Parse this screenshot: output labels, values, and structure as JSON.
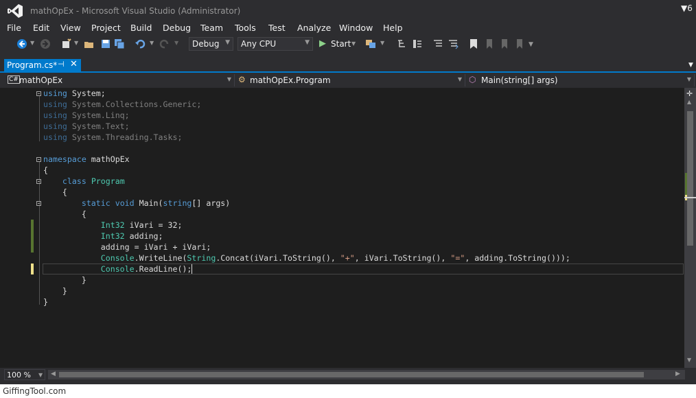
{
  "window": {
    "title": "mathOpEx - Microsoft Visual Studio (Administrator)",
    "notify_count": "6"
  },
  "menu": [
    "File",
    "Edit",
    "View",
    "Project",
    "Build",
    "Debug",
    "Team",
    "Tools",
    "Test",
    "Analyze",
    "Window",
    "Help"
  ],
  "toolbar": {
    "config": "Debug",
    "platform": "Any CPU",
    "start_label": "Start"
  },
  "tab": {
    "label": "Program.cs*"
  },
  "nav": {
    "project": "mathOpEx",
    "class": "mathOpEx.Program",
    "member": "Main(string[] args)"
  },
  "code": {
    "l1": [
      "using",
      " System;"
    ],
    "l2": [
      "using",
      " System.Collections.Generic;"
    ],
    "l3": [
      "using",
      " System.Linq;"
    ],
    "l4": [
      "using",
      " System.Text;"
    ],
    "l5": [
      "using",
      " System.Threading.Tasks;"
    ],
    "l7": [
      "namespace",
      " mathOpEx"
    ],
    "l8": "{",
    "l9": [
      "class",
      "Program"
    ],
    "l10": "{",
    "l11": [
      "static",
      "void",
      " Main(",
      "string",
      "[] args)"
    ],
    "l12": "{",
    "l13": [
      "Int32",
      " iVari = 32;"
    ],
    "l14": [
      "Int32",
      " adding;"
    ],
    "l15": "adding = iVari + iVari;",
    "l16": [
      "Console",
      ".WriteLine(",
      "String",
      ".Concat(iVari.ToString(), ",
      "\"+\"",
      ", iVari.ToString(), ",
      "\"=\"",
      ", adding.ToString()));"
    ],
    "l17": [
      "Console",
      ".ReadLine();"
    ],
    "l18": "}",
    "l19": "}",
    "l20": "}"
  },
  "status": {
    "zoom": "100 %"
  },
  "watermark": "GiffingTool.com"
}
